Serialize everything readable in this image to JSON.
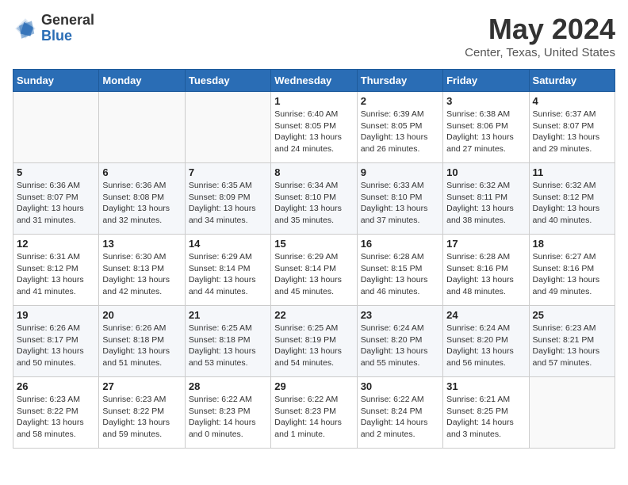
{
  "header": {
    "logo_general": "General",
    "logo_blue": "Blue",
    "title": "May 2024",
    "subtitle": "Center, Texas, United States"
  },
  "weekdays": [
    "Sunday",
    "Monday",
    "Tuesday",
    "Wednesday",
    "Thursday",
    "Friday",
    "Saturday"
  ],
  "weeks": [
    [
      {
        "day": "",
        "sunrise": "",
        "sunset": "",
        "daylight": ""
      },
      {
        "day": "",
        "sunrise": "",
        "sunset": "",
        "daylight": ""
      },
      {
        "day": "",
        "sunrise": "",
        "sunset": "",
        "daylight": ""
      },
      {
        "day": "1",
        "sunrise": "6:40 AM",
        "sunset": "8:05 PM",
        "daylight": "13 hours and 24 minutes."
      },
      {
        "day": "2",
        "sunrise": "6:39 AM",
        "sunset": "8:05 PM",
        "daylight": "13 hours and 26 minutes."
      },
      {
        "day": "3",
        "sunrise": "6:38 AM",
        "sunset": "8:06 PM",
        "daylight": "13 hours and 27 minutes."
      },
      {
        "day": "4",
        "sunrise": "6:37 AM",
        "sunset": "8:07 PM",
        "daylight": "13 hours and 29 minutes."
      }
    ],
    [
      {
        "day": "5",
        "sunrise": "6:36 AM",
        "sunset": "8:07 PM",
        "daylight": "13 hours and 31 minutes."
      },
      {
        "day": "6",
        "sunrise": "6:36 AM",
        "sunset": "8:08 PM",
        "daylight": "13 hours and 32 minutes."
      },
      {
        "day": "7",
        "sunrise": "6:35 AM",
        "sunset": "8:09 PM",
        "daylight": "13 hours and 34 minutes."
      },
      {
        "day": "8",
        "sunrise": "6:34 AM",
        "sunset": "8:10 PM",
        "daylight": "13 hours and 35 minutes."
      },
      {
        "day": "9",
        "sunrise": "6:33 AM",
        "sunset": "8:10 PM",
        "daylight": "13 hours and 37 minutes."
      },
      {
        "day": "10",
        "sunrise": "6:32 AM",
        "sunset": "8:11 PM",
        "daylight": "13 hours and 38 minutes."
      },
      {
        "day": "11",
        "sunrise": "6:32 AM",
        "sunset": "8:12 PM",
        "daylight": "13 hours and 40 minutes."
      }
    ],
    [
      {
        "day": "12",
        "sunrise": "6:31 AM",
        "sunset": "8:12 PM",
        "daylight": "13 hours and 41 minutes."
      },
      {
        "day": "13",
        "sunrise": "6:30 AM",
        "sunset": "8:13 PM",
        "daylight": "13 hours and 42 minutes."
      },
      {
        "day": "14",
        "sunrise": "6:29 AM",
        "sunset": "8:14 PM",
        "daylight": "13 hours and 44 minutes."
      },
      {
        "day": "15",
        "sunrise": "6:29 AM",
        "sunset": "8:14 PM",
        "daylight": "13 hours and 45 minutes."
      },
      {
        "day": "16",
        "sunrise": "6:28 AM",
        "sunset": "8:15 PM",
        "daylight": "13 hours and 46 minutes."
      },
      {
        "day": "17",
        "sunrise": "6:28 AM",
        "sunset": "8:16 PM",
        "daylight": "13 hours and 48 minutes."
      },
      {
        "day": "18",
        "sunrise": "6:27 AM",
        "sunset": "8:16 PM",
        "daylight": "13 hours and 49 minutes."
      }
    ],
    [
      {
        "day": "19",
        "sunrise": "6:26 AM",
        "sunset": "8:17 PM",
        "daylight": "13 hours and 50 minutes."
      },
      {
        "day": "20",
        "sunrise": "6:26 AM",
        "sunset": "8:18 PM",
        "daylight": "13 hours and 51 minutes."
      },
      {
        "day": "21",
        "sunrise": "6:25 AM",
        "sunset": "8:18 PM",
        "daylight": "13 hours and 53 minutes."
      },
      {
        "day": "22",
        "sunrise": "6:25 AM",
        "sunset": "8:19 PM",
        "daylight": "13 hours and 54 minutes."
      },
      {
        "day": "23",
        "sunrise": "6:24 AM",
        "sunset": "8:20 PM",
        "daylight": "13 hours and 55 minutes."
      },
      {
        "day": "24",
        "sunrise": "6:24 AM",
        "sunset": "8:20 PM",
        "daylight": "13 hours and 56 minutes."
      },
      {
        "day": "25",
        "sunrise": "6:23 AM",
        "sunset": "8:21 PM",
        "daylight": "13 hours and 57 minutes."
      }
    ],
    [
      {
        "day": "26",
        "sunrise": "6:23 AM",
        "sunset": "8:22 PM",
        "daylight": "13 hours and 58 minutes."
      },
      {
        "day": "27",
        "sunrise": "6:23 AM",
        "sunset": "8:22 PM",
        "daylight": "13 hours and 59 minutes."
      },
      {
        "day": "28",
        "sunrise": "6:22 AM",
        "sunset": "8:23 PM",
        "daylight": "14 hours and 0 minutes."
      },
      {
        "day": "29",
        "sunrise": "6:22 AM",
        "sunset": "8:23 PM",
        "daylight": "14 hours and 1 minute."
      },
      {
        "day": "30",
        "sunrise": "6:22 AM",
        "sunset": "8:24 PM",
        "daylight": "14 hours and 2 minutes."
      },
      {
        "day": "31",
        "sunrise": "6:21 AM",
        "sunset": "8:25 PM",
        "daylight": "14 hours and 3 minutes."
      },
      {
        "day": "",
        "sunrise": "",
        "sunset": "",
        "daylight": ""
      }
    ]
  ],
  "labels": {
    "sunrise_label": "Sunrise:",
    "sunset_label": "Sunset:",
    "daylight_label": "Daylight:"
  }
}
